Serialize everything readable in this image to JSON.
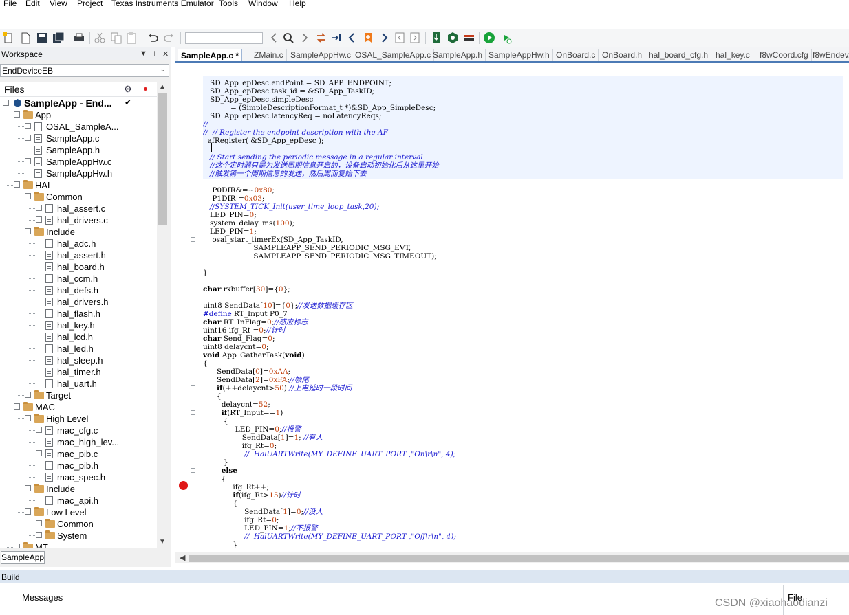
{
  "menu": [
    "File",
    "Edit",
    "View",
    "Project",
    "Texas Instruments Emulator",
    "Tools",
    "Window",
    "Help"
  ],
  "toolbar": {
    "icons": [
      "new-workspace-icon",
      "new-file-icon",
      "save-icon",
      "save-all-icon",
      "print-icon",
      "cut-icon",
      "copy-icon",
      "paste-icon",
      "undo-icon",
      "redo-icon",
      "find-combo",
      "navigate-back-icon",
      "find-icon",
      "navigate-forward-icon",
      "replace-icon",
      "go-to-icon",
      "previous-bookmark-icon",
      "toggle-bookmark-icon",
      "next-bookmark-icon",
      "previous-icon",
      "next-icon",
      "download-icon",
      "make-icon",
      "stop-build-icon",
      "download-and-debug-icon",
      "debug-without-download-icon"
    ],
    "find_value": ""
  },
  "workspace": {
    "title": "Workspace",
    "configuration": "EndDeviceEB",
    "files_header": "Files",
    "tab_label": "SampleApp",
    "tree": [
      {
        "label": "SampleApp - End...",
        "level": 0,
        "kind": "project",
        "toggle": "−",
        "checked": true
      },
      {
        "label": "App",
        "level": 1,
        "kind": "folder",
        "toggle": "−"
      },
      {
        "label": "OSAL_SampleA...",
        "level": 2,
        "kind": "file",
        "toggle": "+"
      },
      {
        "label": "SampleApp.c",
        "level": 2,
        "kind": "file",
        "toggle": "+"
      },
      {
        "label": "SampleApp.h",
        "level": 2,
        "kind": "file",
        "toggle": ""
      },
      {
        "label": "SampleAppHw.c",
        "level": 2,
        "kind": "file",
        "toggle": "+"
      },
      {
        "label": "SampleAppHw.h",
        "level": 2,
        "kind": "file",
        "toggle": ""
      },
      {
        "label": "HAL",
        "level": 1,
        "kind": "folder",
        "toggle": "−"
      },
      {
        "label": "Common",
        "level": 2,
        "kind": "folder",
        "toggle": "−"
      },
      {
        "label": "hal_assert.c",
        "level": 3,
        "kind": "file",
        "toggle": "+"
      },
      {
        "label": "hal_drivers.c",
        "level": 3,
        "kind": "file",
        "toggle": "+"
      },
      {
        "label": "Include",
        "level": 2,
        "kind": "folder",
        "toggle": "−"
      },
      {
        "label": "hal_adc.h",
        "level": 3,
        "kind": "file",
        "toggle": ""
      },
      {
        "label": "hal_assert.h",
        "level": 3,
        "kind": "file",
        "toggle": ""
      },
      {
        "label": "hal_board.h",
        "level": 3,
        "kind": "file",
        "toggle": ""
      },
      {
        "label": "hal_ccm.h",
        "level": 3,
        "kind": "file",
        "toggle": ""
      },
      {
        "label": "hal_defs.h",
        "level": 3,
        "kind": "file",
        "toggle": ""
      },
      {
        "label": "hal_drivers.h",
        "level": 3,
        "kind": "file",
        "toggle": ""
      },
      {
        "label": "hal_flash.h",
        "level": 3,
        "kind": "file",
        "toggle": ""
      },
      {
        "label": "hal_key.h",
        "level": 3,
        "kind": "file",
        "toggle": ""
      },
      {
        "label": "hal_lcd.h",
        "level": 3,
        "kind": "file",
        "toggle": ""
      },
      {
        "label": "hal_led.h",
        "level": 3,
        "kind": "file",
        "toggle": ""
      },
      {
        "label": "hal_sleep.h",
        "level": 3,
        "kind": "file",
        "toggle": ""
      },
      {
        "label": "hal_timer.h",
        "level": 3,
        "kind": "file",
        "toggle": ""
      },
      {
        "label": "hal_uart.h",
        "level": 3,
        "kind": "file",
        "toggle": ""
      },
      {
        "label": "Target",
        "level": 2,
        "kind": "folder",
        "toggle": "+"
      },
      {
        "label": "MAC",
        "level": 1,
        "kind": "folder",
        "toggle": "−"
      },
      {
        "label": "High Level",
        "level": 2,
        "kind": "folder",
        "toggle": "−"
      },
      {
        "label": "mac_cfg.c",
        "level": 3,
        "kind": "file",
        "toggle": "+"
      },
      {
        "label": "mac_high_lev...",
        "level": 3,
        "kind": "file",
        "toggle": ""
      },
      {
        "label": "mac_pib.c",
        "level": 3,
        "kind": "file",
        "toggle": "+"
      },
      {
        "label": "mac_pib.h",
        "level": 3,
        "kind": "file",
        "toggle": ""
      },
      {
        "label": "mac_spec.h",
        "level": 3,
        "kind": "file",
        "toggle": ""
      },
      {
        "label": "Include",
        "level": 2,
        "kind": "folder",
        "toggle": "−"
      },
      {
        "label": "mac_api.h",
        "level": 3,
        "kind": "file",
        "toggle": ""
      },
      {
        "label": "Low Level",
        "level": 2,
        "kind": "folder",
        "toggle": "−"
      },
      {
        "label": "Common",
        "level": 3,
        "kind": "folder",
        "toggle": "+"
      },
      {
        "label": "System",
        "level": 3,
        "kind": "folder",
        "toggle": "+"
      },
      {
        "label": "MT",
        "level": 1,
        "kind": "folder",
        "toggle": "+"
      }
    ]
  },
  "editor": {
    "tabs": [
      "SampleApp.c *",
      "ZMain.c",
      "SampleAppHw.c",
      "OSAL_SampleApp.c",
      "SampleApp.h",
      "SampleAppHw.h",
      "OnBoard.c",
      "OnBoard.h",
      "hal_board_cfg.h",
      "hal_key.c",
      "f8wCoord.cfg",
      "f8wEndev..."
    ],
    "active_tab": 0,
    "lines": [
      [
        [
          "",
          "   SD_App_epDesc.endPoint = SD_APP_ENDPOINT;"
        ]
      ],
      [
        [
          "",
          "   SD_App_epDesc.task_id = &SD_App_TaskID;"
        ]
      ],
      [
        [
          "",
          "   SD_App_epDesc.simpleDesc"
        ]
      ],
      [
        [
          "",
          "            = (SimpleDescriptionFormat_t *)&SD_App_SimpleDesc;"
        ]
      ],
      [
        [
          "",
          "   SD_App_epDesc.latencyReq = noLatencyReqs;"
        ]
      ],
      [
        [
          "cm",
          "//"
        ]
      ],
      [
        [
          "cm",
          "//  // Register the endpoint description with the AF"
        ]
      ],
      [
        [
          "",
          "  afRegister( &SD_App_epDesc );"
        ]
      ],
      [
        [
          "",
          " "
        ]
      ],
      [
        [
          "cm",
          "   // Start sending the periodic message in a regular interval."
        ]
      ],
      [
        [
          "cm",
          "   //这个定时器只是为发送周期信息开启的，设备启动初始化后从这里开始"
        ]
      ],
      [
        [
          "cm",
          "   //触发第一个周期信息的发送，然后周而复始下去"
        ]
      ],
      [
        [
          "",
          " "
        ]
      ],
      [
        [
          "",
          "    P0DIR&=~"
        ],
        [
          "nm",
          "0x80"
        ],
        [
          "",
          ";"
        ]
      ],
      [
        [
          "",
          "    P1DIR|="
        ],
        [
          "nm",
          "0x03"
        ],
        [
          "",
          ";"
        ]
      ],
      [
        [
          "cm",
          "   //SYSTEM_TICK_Init(user_time_loop_task,20);"
        ]
      ],
      [
        [
          "",
          "   LED_PIN="
        ],
        [
          "nm",
          "0"
        ],
        [
          "",
          ";"
        ]
      ],
      [
        [
          "",
          "   system_delay_ms("
        ],
        [
          "nm",
          "100"
        ],
        [
          "",
          ");"
        ]
      ],
      [
        [
          "",
          "   LED_PIN="
        ],
        [
          "nm",
          "1"
        ],
        [
          "",
          ";"
        ]
      ],
      [
        [
          "",
          "    osal_start_timerEx(SD_App_TaskID,"
        ]
      ],
      [
        [
          "",
          "                      SAMPLEAPP_SEND_PERIODIC_MSG_EVT,"
        ]
      ],
      [
        [
          "",
          "                      SAMPLEAPP_SEND_PERIODIC_MSG_TIMEOUT);"
        ]
      ],
      [
        [
          "",
          " "
        ]
      ],
      [
        [
          "",
          "}"
        ]
      ],
      [
        [
          "",
          " "
        ]
      ],
      [
        [
          "kw",
          "char"
        ],
        [
          "",
          " rxbuffer["
        ],
        [
          "nm",
          "30"
        ],
        [
          "",
          "]={"
        ],
        [
          "nm",
          "0"
        ],
        [
          "",
          "};"
        ]
      ],
      [
        [
          "",
          " "
        ]
      ],
      [
        [
          "",
          "uint8 SendData["
        ],
        [
          "nm",
          "10"
        ],
        [
          "",
          "]={"
        ],
        [
          "nm",
          "0"
        ],
        [
          "",
          "};"
        ],
        [
          "cm",
          "//发送数据缓存区"
        ]
      ],
      [
        [
          "pp",
          "#define"
        ],
        [
          "",
          " RT_Input P0_7"
        ]
      ],
      [
        [
          "kw",
          "char"
        ],
        [
          "",
          " RT_InFlag="
        ],
        [
          "nm",
          "0"
        ],
        [
          "",
          ";"
        ],
        [
          "cm",
          "//感应标志"
        ]
      ],
      [
        [
          "",
          "uint16 ifg_Rt ="
        ],
        [
          "nm",
          "0"
        ],
        [
          "",
          ";"
        ],
        [
          "cm",
          "//计时"
        ]
      ],
      [
        [
          "kw",
          "char"
        ],
        [
          "",
          " Send_Flag="
        ],
        [
          "nm",
          "0"
        ],
        [
          "",
          ";"
        ]
      ],
      [
        [
          "",
          "uint8 delaycnt="
        ],
        [
          "nm",
          "0"
        ],
        [
          "",
          ";"
        ]
      ],
      [
        [
          "kw",
          "void"
        ],
        [
          "",
          " App_GatherTask("
        ],
        [
          "kw",
          "void"
        ],
        [
          "",
          ")"
        ]
      ],
      [
        [
          "",
          "{"
        ]
      ],
      [
        [
          "",
          "      SendData["
        ],
        [
          "nm",
          "0"
        ],
        [
          "",
          "]="
        ],
        [
          "nm",
          "0xAA"
        ],
        [
          "",
          ";"
        ]
      ],
      [
        [
          "",
          "      SendData["
        ],
        [
          "nm",
          "2"
        ],
        [
          "",
          "]="
        ],
        [
          "nm",
          "0xFA"
        ],
        [
          "",
          ";"
        ],
        [
          "cm",
          "//帧尾"
        ]
      ],
      [
        [
          "",
          "      "
        ],
        [
          "kw",
          "if"
        ],
        [
          "",
          "(++delaycnt>"
        ],
        [
          "nm",
          "50"
        ],
        [
          "",
          ") "
        ],
        [
          "cm",
          "//上电延时一段时间"
        ]
      ],
      [
        [
          "",
          "      {"
        ]
      ],
      [
        [
          "",
          "        delaycnt="
        ],
        [
          "nm",
          "52"
        ],
        [
          "",
          ";"
        ]
      ],
      [
        [
          "",
          "        "
        ],
        [
          "kw",
          "if"
        ],
        [
          "",
          "(RT_Input=="
        ],
        [
          "nm",
          "1"
        ],
        [
          "",
          ")"
        ]
      ],
      [
        [
          "",
          "         {"
        ]
      ],
      [
        [
          "",
          "              LED_PIN="
        ],
        [
          "nm",
          "0"
        ],
        [
          "",
          ";"
        ],
        [
          "cm",
          "//报警"
        ]
      ],
      [
        [
          "",
          "                 SendData["
        ],
        [
          "nm",
          "1"
        ],
        [
          "",
          "]="
        ],
        [
          "nm",
          "1"
        ],
        [
          "",
          "; "
        ],
        [
          "cm",
          "//有人"
        ]
      ],
      [
        [
          "",
          "                 ifg_Rt="
        ],
        [
          "nm",
          "0"
        ],
        [
          "",
          ";"
        ]
      ],
      [
        [
          "cm",
          "                  //  HalUARTWrite(MY_DEFINE_UART_PORT ,\"On\\r\\n\", 4);"
        ]
      ],
      [
        [
          "",
          "         }"
        ]
      ],
      [
        [
          "",
          "        "
        ],
        [
          "kw",
          "else"
        ]
      ],
      [
        [
          "",
          "        {"
        ]
      ],
      [
        [
          "",
          "             ifg_Rt++;"
        ]
      ],
      [
        [
          "",
          "             "
        ],
        [
          "kw",
          "if"
        ],
        [
          "",
          "(ifg_Rt>"
        ],
        [
          "nm",
          "15"
        ],
        [
          "",
          ")"
        ],
        [
          "cm",
          "//计时"
        ]
      ],
      [
        [
          "",
          "             {"
        ]
      ],
      [
        [
          "",
          "                  SendData["
        ],
        [
          "nm",
          "1"
        ],
        [
          "",
          "]="
        ],
        [
          "nm",
          "0"
        ],
        [
          "",
          ";"
        ],
        [
          "cm",
          "//没人"
        ]
      ],
      [
        [
          "",
          "                  ifg_Rt="
        ],
        [
          "nm",
          "0"
        ],
        [
          "",
          ";"
        ]
      ],
      [
        [
          "",
          "                  LED_PIN="
        ],
        [
          "nm",
          "1"
        ],
        [
          "",
          ";"
        ],
        [
          "cm",
          "//不报警"
        ]
      ],
      [
        [
          "cm",
          "                  //  HalUARTWrite(MY_DEFINE_UART_PORT ,\"Off\\r\\n\", 4);"
        ]
      ],
      [
        [
          "",
          "             }"
        ]
      ],
      [
        [
          "",
          "        }"
        ]
      ]
    ]
  },
  "build": {
    "title": "Build",
    "messages_header": "Messages",
    "file_header": "File"
  },
  "watermark": "CSDN @xiaohaodianzi",
  "colors": {
    "keyword": "#000000",
    "comment": "#1a1ad1",
    "number": "#c2410c",
    "preprocessor": "#0000c8",
    "tab_accent": "#4c7ab5",
    "breakpoint": "#e01818"
  }
}
